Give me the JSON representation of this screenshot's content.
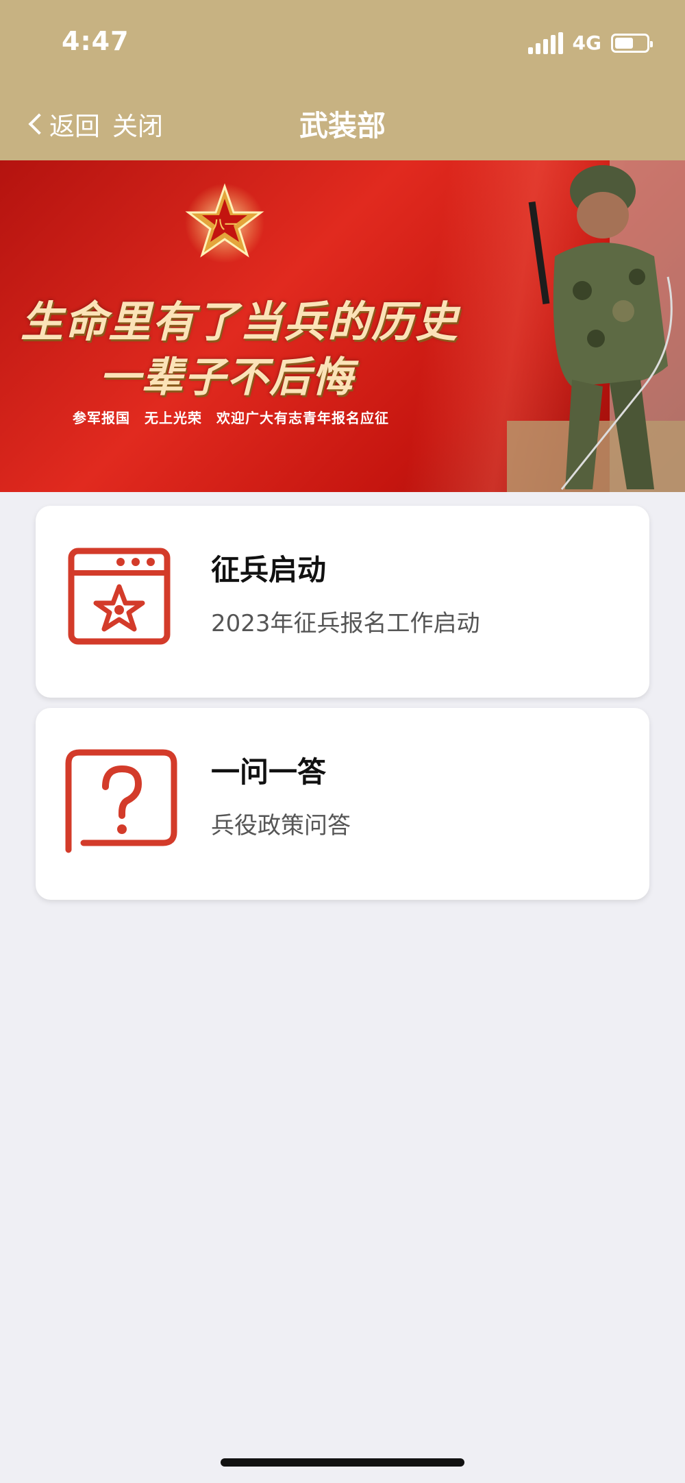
{
  "status_bar": {
    "time": "4:47",
    "network": "4G",
    "battery_level": 0.6,
    "icons": [
      "signal-icon",
      "battery-icon"
    ]
  },
  "nav": {
    "back_label": "返回",
    "close_label": "关闭",
    "title": "武装部",
    "bar_color": "#c7b282"
  },
  "banner": {
    "line1": "生命里有了当兵的历史",
    "line2": "一辈子不后悔",
    "slogan": "参军报国　无上光荣　欢迎广大有志青年报名应征",
    "star_text": "八一",
    "colors": {
      "red": "#d61f16",
      "gold": "#e8b04a"
    }
  },
  "cards": [
    {
      "title": "征兵启动",
      "subtitle": "2023年征兵报名工作启动",
      "icon": "browser-star-icon"
    },
    {
      "title": "一问一答",
      "subtitle": "兵役政策问答",
      "icon": "question-icon"
    }
  ],
  "accent_color": "#d33b2a"
}
